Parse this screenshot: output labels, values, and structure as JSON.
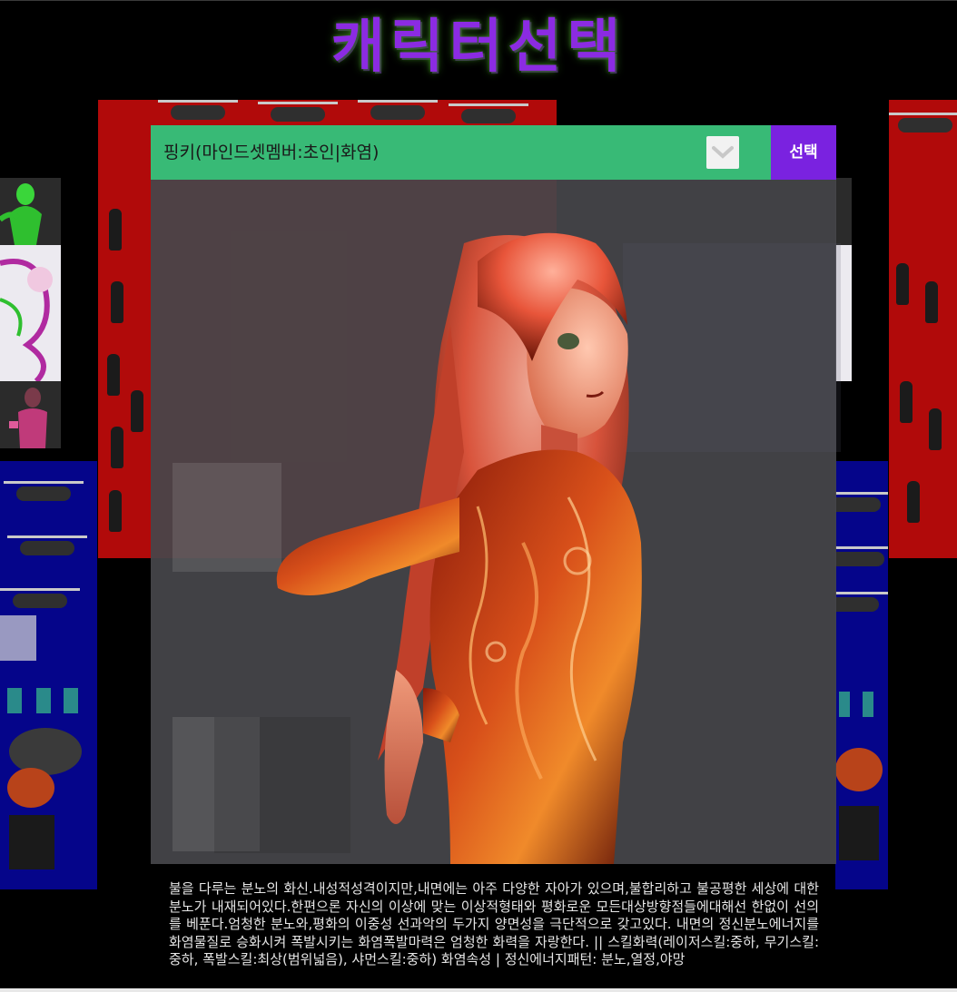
{
  "page": {
    "title": "캐릭터선택"
  },
  "selector": {
    "selected_value": "핑키(마인드셋멤버:초인|화염)",
    "button_label": "선택",
    "arrow_icon": "chevron-down-icon"
  },
  "character": {
    "portrait_icon": "character-portrait",
    "description": "불을 다루는 분노의 화신.내성적성격이지만,내면에는 아주 다양한 자아가 있으며,불합리하고 불공평한 세상에 대한 분노가 내재되어있다.한편으론 자신의 이상에 맞는 이상적형태와 평화로운 모든대상방향점들에대해선 한없이 선의를 베푼다.엄청한 분노와,평화의 이중성 선과악의 두가지 양면성을 극단적으로 갖고있다. 내면의 정신분노에너지를 화염물질로 승화시켜 폭발시키는 화염폭발마력은 엄청한 화력을 자랑한다. || 스킬화력(레이저스킬:중하, 무기스킬:중하, 폭발스킬:최상(범위넓음), 샤먼스킬:중하) 화염속성 | 정신에너지패턴: 분노,열정,야망"
  },
  "colors": {
    "title": "#8b2be2",
    "select_bar": "#38be78",
    "select_button": "#7a22e0",
    "background": "#000000"
  }
}
